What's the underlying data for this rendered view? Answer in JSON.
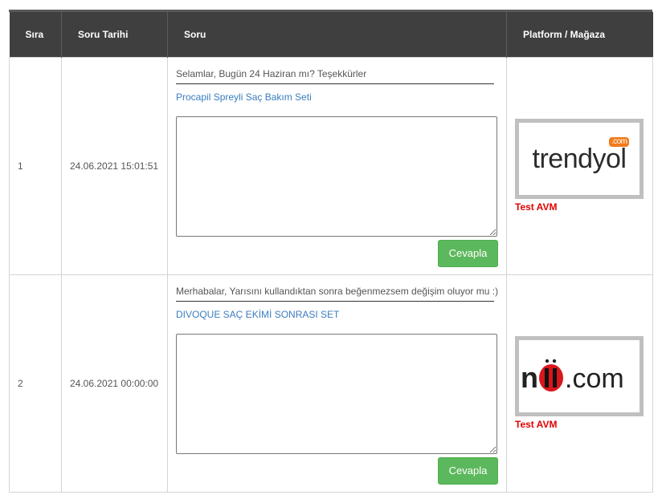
{
  "table": {
    "headers": [
      "Sıra",
      "Soru Tarihi",
      "Soru",
      "Platform / Mağaza"
    ],
    "rows": [
      {
        "index": "1",
        "date": "24.06.2021 15:01:51",
        "question": "Selamlar, Bugün 24 Haziran mı? Teşekkürler",
        "product": "Procapil Spreyli Saç Bakım Seti",
        "answer_value": "",
        "reply_label": "Cevapla",
        "platform_logo_text": "trendyol",
        "platform_logo_badge": ".com",
        "store": "Test AVM"
      },
      {
        "index": "2",
        "date": "24.06.2021 00:00:00",
        "question": "Merhabalar, Yarısını kullandıktan sonra beğenmezsem değişim oluyor mu :)",
        "product": "DIVOQUE SAÇ EKİMİ SONRASI SET",
        "answer_value": "",
        "reply_label": "Cevapla",
        "platform_logo_text": "n11.com",
        "store": "Test AVM"
      }
    ]
  },
  "colors": {
    "header_bg": "#3f3f3f",
    "link": "#3a7dbf",
    "button": "#5cb85c",
    "store_text": "#e00000",
    "trendyol_orange": "#f27a1a",
    "n11_red": "#d9161c"
  }
}
